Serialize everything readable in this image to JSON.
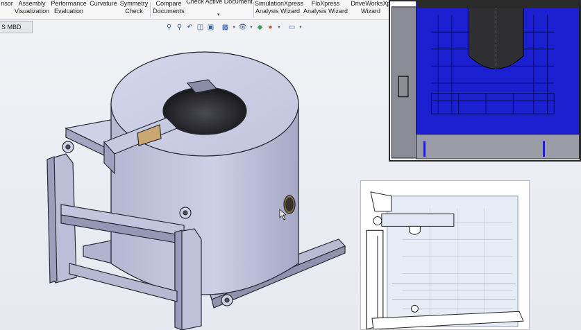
{
  "ribbon": {
    "items": [
      {
        "line1": "nsor",
        "line2": ""
      },
      {
        "line1": "Assembly",
        "line2": "Visualization"
      },
      {
        "line1": "Performance",
        "line2": "Evaluation"
      },
      {
        "line1": "Curvature",
        "line2": ""
      },
      {
        "line1": "Symmetry",
        "line2": "Check"
      },
      {
        "line1": "Compare",
        "line2": "Documents"
      },
      {
        "line1": "Check Active Document",
        "line2": ""
      },
      {
        "line1": "SimulationXpress",
        "line2": "Analysis Wizard"
      },
      {
        "line1": "FloXpress",
        "line2": "Analysis Wizard"
      },
      {
        "line1": "DriveWorksXp",
        "line2": "Wizard"
      }
    ]
  },
  "tab": {
    "label": "S MBD"
  },
  "hud_icons": [
    "zoom-to-fit-icon",
    "zoom-area-icon",
    "previous-view-icon",
    "section-view-icon",
    "view-orientation-icon",
    "display-style-icon",
    "hide-show-icon",
    "edit-appearance-icon",
    "apply-scene-icon",
    "view-settings-icon",
    "monitor-icon"
  ],
  "colors": {
    "part_fill": "#c9cbe0",
    "part_dark": "#9a9cb8",
    "section_blue": "#1a1fd0",
    "hole_dark": "#2b2b2f"
  }
}
